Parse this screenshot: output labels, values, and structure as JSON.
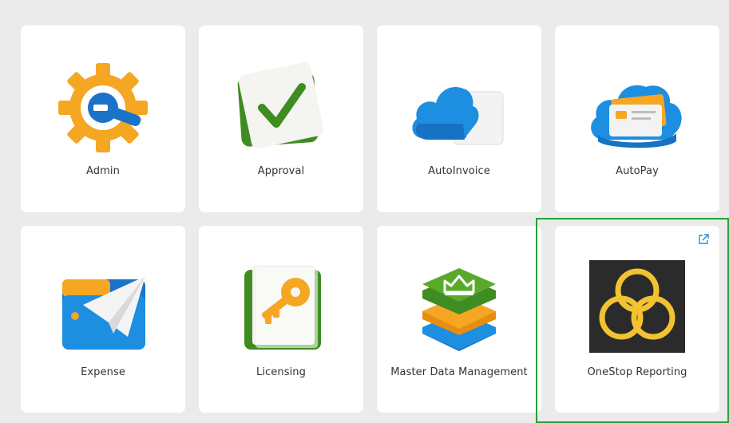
{
  "colors": {
    "background": "#ebebeb",
    "tile": "#ffffff",
    "selection_border": "#27a03a",
    "link_icon": "#2a8fd6"
  },
  "apps": [
    {
      "label": "Admin",
      "icon": "gear-wrench-icon"
    },
    {
      "label": "Approval",
      "icon": "checkmark-card-icon"
    },
    {
      "label": "AutoInvoice",
      "icon": "cloud-invoice-icon"
    },
    {
      "label": "AutoPay",
      "icon": "cloud-card-icon"
    },
    {
      "label": "Expense",
      "icon": "wallet-paper-plane-icon"
    },
    {
      "label": "Licensing",
      "icon": "key-document-icon"
    },
    {
      "label": "Master Data Management",
      "icon": "crown-stack-icon"
    },
    {
      "label": "OneStop Reporting",
      "icon": "onestop-logo-icon",
      "external": true,
      "selected": true
    }
  ]
}
